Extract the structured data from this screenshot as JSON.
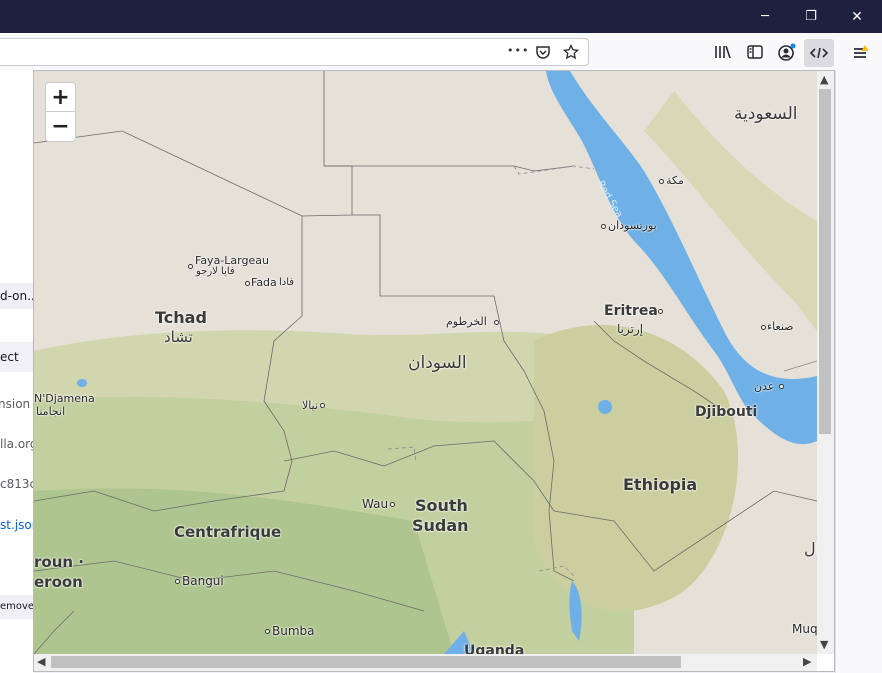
{
  "window": {
    "minimize": "─",
    "restore": "❐",
    "close": "✕"
  },
  "toolbar": {
    "more_label": "•••"
  },
  "background_page": {
    "rows": [
      "d-on...",
      "ect",
      "nsion",
      "lla.org",
      "c813c",
      "st.json",
      "emove"
    ]
  },
  "map": {
    "zoom_in": "+",
    "zoom_out": "−",
    "labels": {
      "saudi": "السعودية",
      "makkah": "مكة",
      "port_sudan": "بورتسودان",
      "red_sea": "Red Sea",
      "faya_largeau": "Faya-Largeau",
      "faya_largeau_ar": "فايا لارجو",
      "fada": "Fada",
      "fada_ar": "فادا",
      "tchad": "Tchad",
      "tchad_ar": "تشاد",
      "khartoum": "الخرطوم",
      "eritrea": "Eritrea",
      "eritrea_ar": "إرتريا",
      "sanaa": "صنعاء",
      "sudan": "السودان",
      "aden": "عدن",
      "ndjamena": "N'Djamena",
      "ndjamena_ar": "انجامنا",
      "nyala": "نيالا",
      "djibouti": "Djibouti",
      "ethiopia": "Ethiopia",
      "wau": "Wau",
      "south": "South",
      "sudan_en": "Sudan",
      "centrafrique": "Centrafrique",
      "cameroun_top": "roun ·",
      "cameroun_bottom": "eroon",
      "bangui": "Bangui",
      "bumba": "Bumba",
      "uganda": "Uganda",
      "muq": "Muq",
      "right_cut": "ال"
    }
  },
  "colors": {
    "water": "#6fb0e6",
    "desert": "#e5e0d8",
    "green": "#c7d2a3",
    "titlebar": "#1e2040"
  }
}
